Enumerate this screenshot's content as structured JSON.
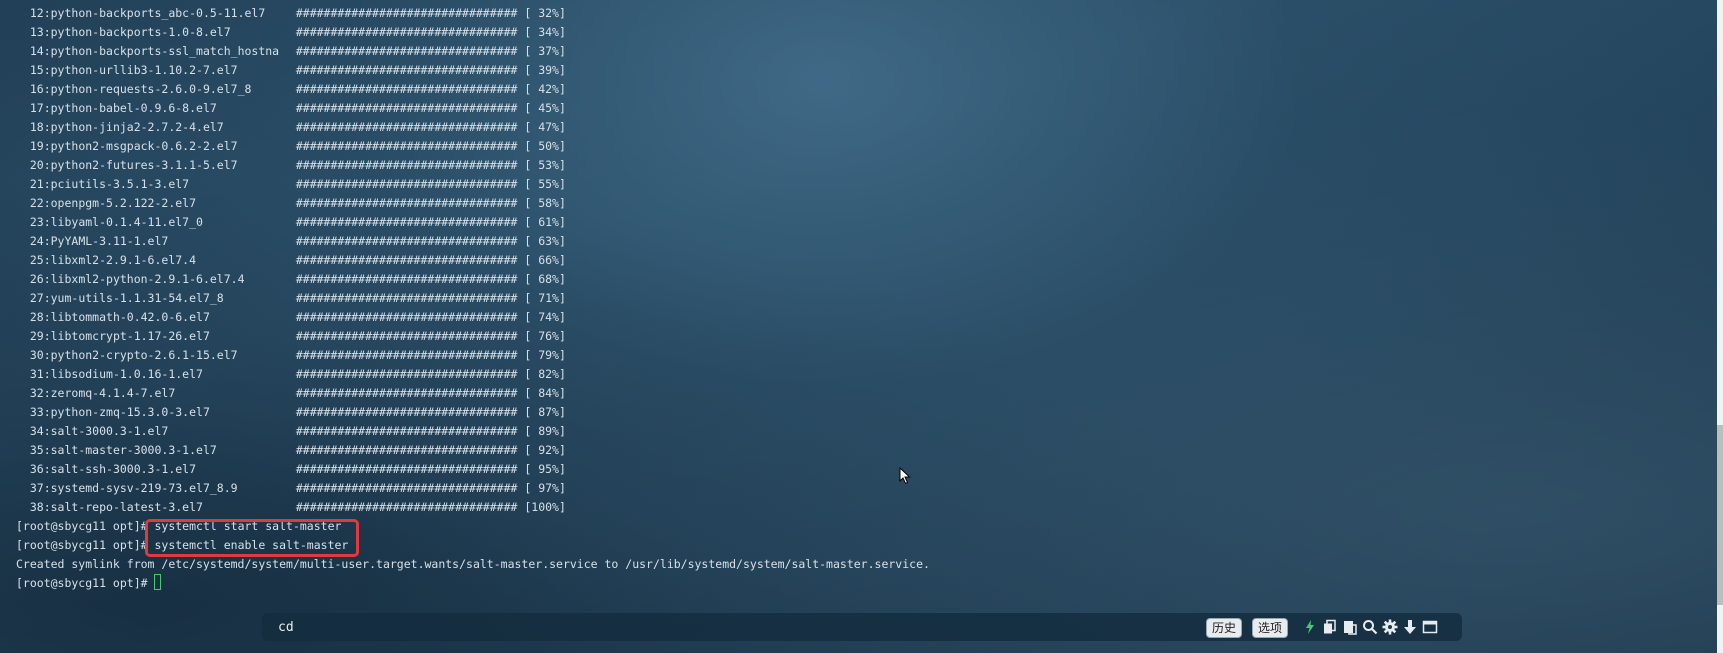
{
  "terminal": {
    "install_rows": [
      {
        "name": "12:python-backports_abc-0.5-11.el7",
        "bar": "################################",
        "pct": "[ 32%]"
      },
      {
        "name": "13:python-backports-1.0-8.el7",
        "bar": "################################",
        "pct": "[ 34%]"
      },
      {
        "name": "14:python-backports-ssl_match_hostna",
        "bar": "################################",
        "pct": "[ 37%]"
      },
      {
        "name": "15:python-urllib3-1.10.2-7.el7",
        "bar": "################################",
        "pct": "[ 39%]"
      },
      {
        "name": "16:python-requests-2.6.0-9.el7_8",
        "bar": "################################",
        "pct": "[ 42%]"
      },
      {
        "name": "17:python-babel-0.9.6-8.el7",
        "bar": "################################",
        "pct": "[ 45%]"
      },
      {
        "name": "18:python-jinja2-2.7.2-4.el7",
        "bar": "################################",
        "pct": "[ 47%]"
      },
      {
        "name": "19:python2-msgpack-0.6.2-2.el7",
        "bar": "################################",
        "pct": "[ 50%]"
      },
      {
        "name": "20:python2-futures-3.1.1-5.el7",
        "bar": "################################",
        "pct": "[ 53%]"
      },
      {
        "name": "21:pciutils-3.5.1-3.el7",
        "bar": "################################",
        "pct": "[ 55%]"
      },
      {
        "name": "22:openpgm-5.2.122-2.el7",
        "bar": "################################",
        "pct": "[ 58%]"
      },
      {
        "name": "23:libyaml-0.1.4-11.el7_0",
        "bar": "################################",
        "pct": "[ 61%]"
      },
      {
        "name": "24:PyYAML-3.11-1.el7",
        "bar": "################################",
        "pct": "[ 63%]"
      },
      {
        "name": "25:libxml2-2.9.1-6.el7.4",
        "bar": "################################",
        "pct": "[ 66%]"
      },
      {
        "name": "26:libxml2-python-2.9.1-6.el7.4",
        "bar": "################################",
        "pct": "[ 68%]"
      },
      {
        "name": "27:yum-utils-1.1.31-54.el7_8",
        "bar": "################################",
        "pct": "[ 71%]"
      },
      {
        "name": "28:libtommath-0.42.0-6.el7",
        "bar": "################################",
        "pct": "[ 74%]"
      },
      {
        "name": "29:libtomcrypt-1.17-26.el7",
        "bar": "################################",
        "pct": "[ 76%]"
      },
      {
        "name": "30:python2-crypto-2.6.1-15.el7",
        "bar": "################################",
        "pct": "[ 79%]"
      },
      {
        "name": "31:libsodium-1.0.16-1.el7",
        "bar": "################################",
        "pct": "[ 82%]"
      },
      {
        "name": "32:zeromq-4.1.4-7.el7",
        "bar": "################################",
        "pct": "[ 84%]"
      },
      {
        "name": "33:python-zmq-15.3.0-3.el7",
        "bar": "################################",
        "pct": "[ 87%]"
      },
      {
        "name": "34:salt-3000.3-1.el7",
        "bar": "################################",
        "pct": "[ 89%]"
      },
      {
        "name": "35:salt-master-3000.3-1.el7",
        "bar": "################################",
        "pct": "[ 92%]"
      },
      {
        "name": "36:salt-ssh-3000.3-1.el7",
        "bar": "################################",
        "pct": "[ 95%]"
      },
      {
        "name": "37:systemd-sysv-219-73.el7_8.9",
        "bar": "################################",
        "pct": "[ 97%]"
      },
      {
        "name": "38:salt-repo-latest-3.el7",
        "bar": "################################",
        "pct": "[100%]"
      }
    ],
    "prompt": "[root@sbycg11 opt]# ",
    "command_1": "systemctl start salt-master",
    "command_2": "systemctl enable salt-master",
    "output_line": "Created symlink from /etc/systemd/system/multi-user.target.wants/salt-master.service to /usr/lib/systemd/system/salt-master.service.",
    "cursor_color": "#3ecf6a",
    "highlight_color": "#e0393e"
  },
  "command_bar": {
    "input_value": "cd",
    "history_label": "历史",
    "options_label": "选项",
    "icons": [
      "lightning-icon",
      "copy-icon",
      "paste-icon",
      "search-icon",
      "gear-icon",
      "download-icon",
      "window-icon"
    ]
  }
}
